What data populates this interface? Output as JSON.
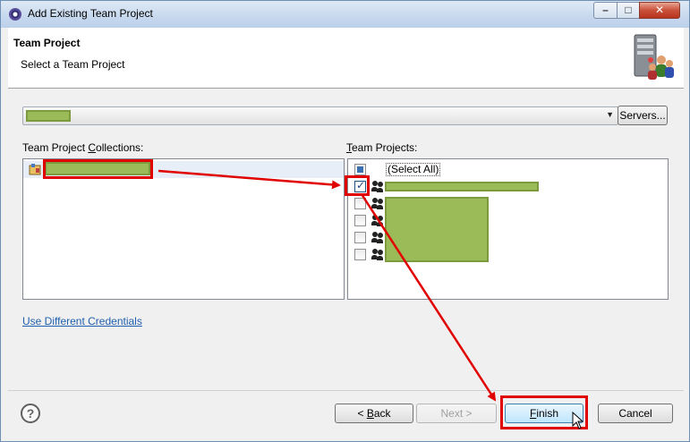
{
  "window": {
    "title": "Add Existing Team Project",
    "minimize": "–",
    "maximize": "□",
    "close": "✕"
  },
  "header": {
    "title": "Team Project",
    "subtitle": "Select a Team Project",
    "icon": "server-users-icon"
  },
  "server": {
    "servers_button": "Servers..."
  },
  "collections": {
    "label_pre": "Team Project ",
    "label_accel": "C",
    "label_post": "ollections:"
  },
  "projects": {
    "label_accel": "T",
    "label_post": "eam Projects:",
    "select_all": "(Select All)",
    "items": [
      {
        "checked": true
      },
      {
        "checked": false
      },
      {
        "checked": false
      },
      {
        "checked": false
      },
      {
        "checked": false
      }
    ]
  },
  "credentials_link": "Use Different Credentials",
  "footer": {
    "back_pre": "< ",
    "back_accel": "B",
    "back_post": "ack",
    "next": "Next >",
    "finish_accel": "F",
    "finish_post": "inish",
    "cancel": "Cancel"
  },
  "colors": {
    "redaction": "#9bbb59",
    "annotation": "#e00000",
    "link": "#1f5fae"
  }
}
